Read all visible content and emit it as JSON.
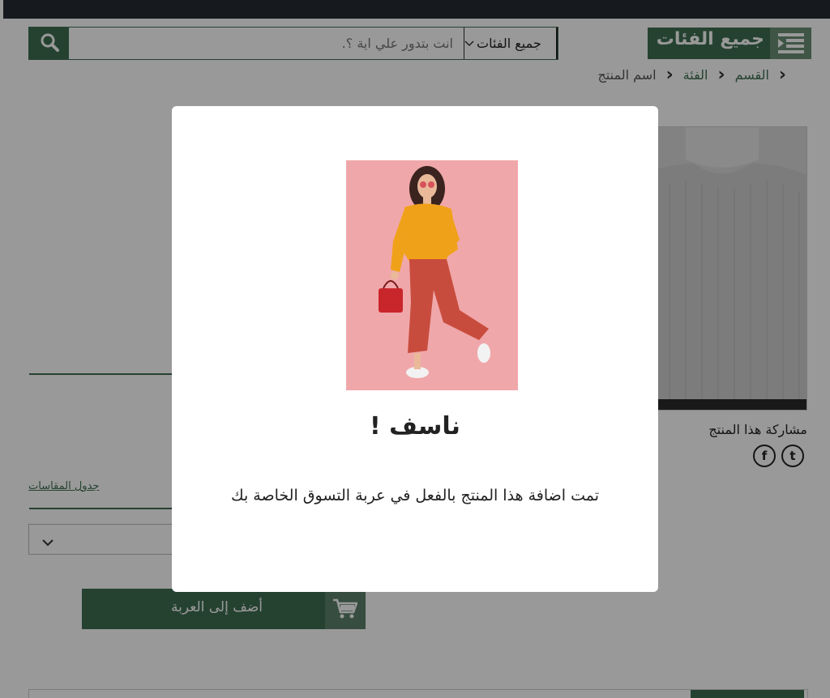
{
  "header": {
    "categories_label": "جميع الفئات",
    "search": {
      "placeholder": "انت بتدور علي اية ؟.",
      "category_select": "جميع الفئات"
    }
  },
  "breadcrumb": {
    "items": [
      "القسم",
      "الفئة",
      "اسم المنتج"
    ]
  },
  "product": {
    "share_title": "مشاركة هذا المنتج",
    "social": [
      "twitter",
      "facebook"
    ],
    "size_chart_link": "جدول المقاسات",
    "add_to_cart_label": "أضف إلى العربة"
  },
  "modal": {
    "title": "ناسف !",
    "message": "تمت اضافة هذا المنتج بالفعل في عربة التسوق الخاصة بك"
  },
  "colors": {
    "brand_green": "#3f6e52",
    "topbar": "#262b33",
    "modal_photo_bg": "#f0a7a9"
  }
}
